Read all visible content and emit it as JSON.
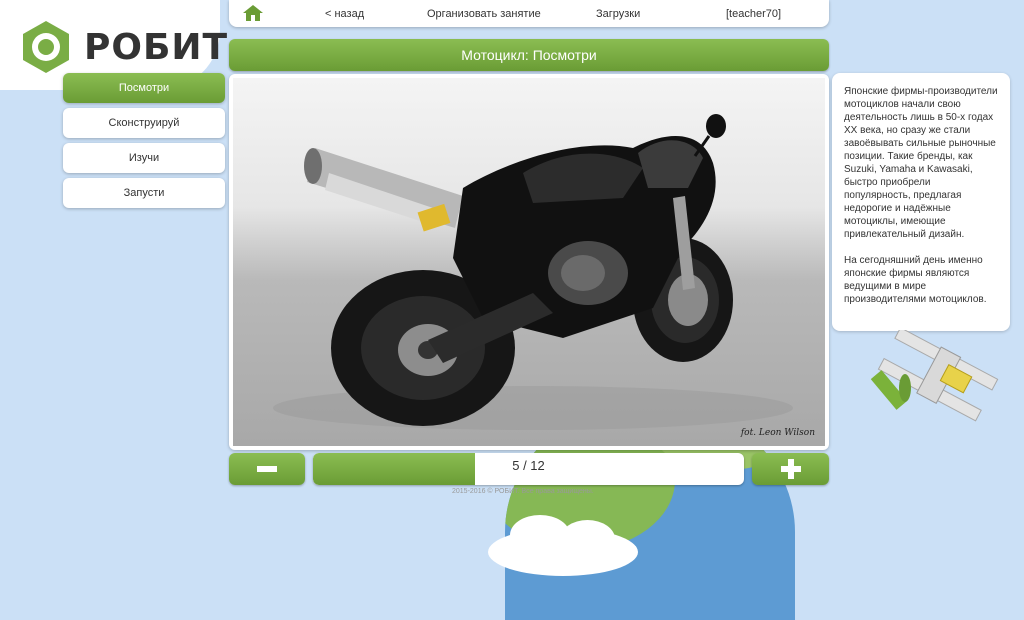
{
  "topbar": {
    "home_icon": "home-icon",
    "back_label": "< назад",
    "organize_label": "Организовать занятие",
    "downloads_label": "Загрузки",
    "user_label": "[teacher70]"
  },
  "logo": {
    "text": "РОБИТ"
  },
  "page_title": "Мотоцикл: Посмотри",
  "menu": {
    "items": [
      {
        "label": "Посмотри"
      },
      {
        "label": "Сконструируй"
      },
      {
        "label": "Изучи"
      },
      {
        "label": "Запусти"
      }
    ]
  },
  "photo": {
    "credit": "fot. Leon Wilson"
  },
  "info": {
    "paragraph1": "Японские фирмы-производители мотоциклов начали свою деятельность лишь в 50-х годах XX века, но сразу же стали завоёвывать сильные рыночные позиции. Такие бренды, как Suzuki, Yamaha и Kawasaki, быстро приобрели популярность, предлагая недорогие и надёжные мотоциклы, имеющие привлекательный дизайн.",
    "paragraph2": "На сегодняшний день именно японские фирмы являются ведущими в мире производителями мотоциклов."
  },
  "pager": {
    "counter": "5 / 12",
    "progress": 0.375,
    "minus_icon": "minus-icon",
    "plus_icon": "plus-icon"
  },
  "footer": {
    "text": "2015-2016 © РОБИТ. Все права защищены."
  },
  "colors": {
    "accent_green": "#7aad45",
    "background": "#cbe0f6"
  }
}
